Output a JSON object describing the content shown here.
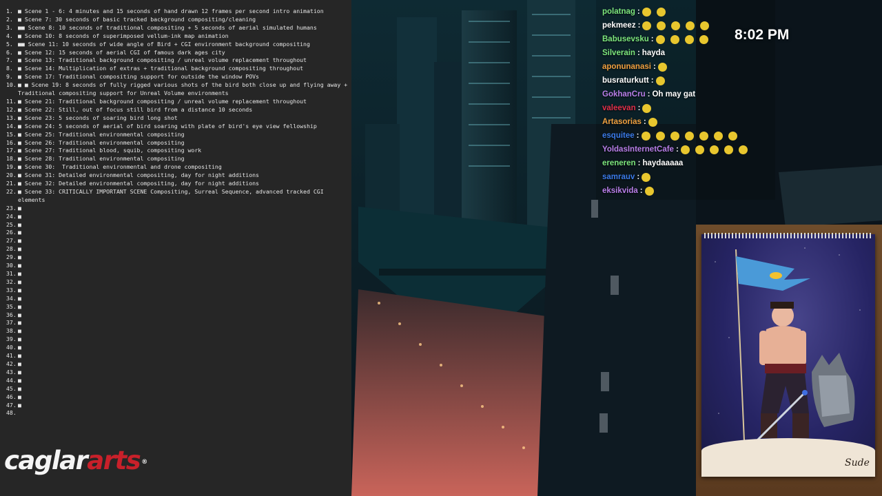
{
  "notes": [
    {
      "n": "1.",
      "t": "■ Scene 1 - 6: 4 minutes and 15 seconds of hand drawn 12 frames per second intro animation"
    },
    {
      "n": "2.",
      "t": "■ Scene 7: 30 seconds of basic tracked background compositing/cleaning"
    },
    {
      "n": "3.",
      "t": "■■ Scene 8: 10 seconds of traditional compositing + 5 seconds of aerial simulated humans"
    },
    {
      "n": "4.",
      "t": "■ Scene 10: 8 seconds of superimposed vellum-ink map animation"
    },
    {
      "n": "5.",
      "t": "■■ Scene 11: 10 seconds of wide angle of Bird + CGI environment background compositing"
    },
    {
      "n": "6.",
      "t": "■ Scene 12: 15 seconds of aerial CGI of famous dark ages city"
    },
    {
      "n": "7.",
      "t": "■ Scene 13: Traditional background compositing / unreal volume replacement throughout"
    },
    {
      "n": "8.",
      "t": "■ Scene 14: Multiplication of extras + traditional background compositing throughout"
    },
    {
      "n": "9.",
      "t": "■ Scene 17: Traditional compositing support for outside the window POVs"
    },
    {
      "n": "10.",
      "t": "■ ■ Scene 19: 8 seconds of fully rigged various shots of the bird both close up and flying away + Traditional compositing support for Unreal Volume environments"
    },
    {
      "n": "11.",
      "t": "■ Scene 21: Traditional background compositing / unreal volume replacement throughout"
    },
    {
      "n": "12.",
      "t": "■ Scene 22: Still, out of focus still bird from a distance 10 seconds"
    },
    {
      "n": "13.",
      "t": "■ Scene 23: 5 seconds of soaring bird long shot"
    },
    {
      "n": "14.",
      "t": "■ Scene 24: 5 seconds of aerial of bird soaring with plate of bird's eye view fellowship"
    },
    {
      "n": "15.",
      "t": "■ Scene 25: Traditional environmental compositing"
    },
    {
      "n": "16.",
      "t": "■ Scene 26: Traditional environmental compositing"
    },
    {
      "n": "17.",
      "t": "■ Scene 27: Traditional blood, squib, compositing work"
    },
    {
      "n": "18.",
      "t": "■ Scene 28: Traditional environmental compositing"
    },
    {
      "n": "19.",
      "t": "■ Scene 30:  Traditional environmental and drone compositing"
    },
    {
      "n": "20.",
      "t": "■ Scene 31: Detailed environmental compositing, day for night additions"
    },
    {
      "n": "21.",
      "t": "■ Scene 32: Detailed environmental compositing, day for night additions"
    },
    {
      "n": "22.",
      "t": "■ Scene 33: CRITICALLY IMPORTANT SCENE Compositing, Surreal Sequence, advanced tracked CGI elements"
    },
    {
      "n": "23.",
      "t": "■"
    },
    {
      "n": "24.",
      "t": "■"
    },
    {
      "n": "25.",
      "t": "■"
    },
    {
      "n": "26.",
      "t": "■"
    },
    {
      "n": "27.",
      "t": "■"
    },
    {
      "n": "28.",
      "t": "■"
    },
    {
      "n": "29.",
      "t": "■"
    },
    {
      "n": "30.",
      "t": "■"
    },
    {
      "n": "31.",
      "t": "■"
    },
    {
      "n": "32.",
      "t": "■"
    },
    {
      "n": "33.",
      "t": "■"
    },
    {
      "n": "34.",
      "t": "■"
    },
    {
      "n": "35.",
      "t": "■"
    },
    {
      "n": "36.",
      "t": "■"
    },
    {
      "n": "37.",
      "t": "■"
    },
    {
      "n": "38.",
      "t": "■"
    },
    {
      "n": "39.",
      "t": "■"
    },
    {
      "n": "40.",
      "t": "■"
    },
    {
      "n": "41.",
      "t": "■"
    },
    {
      "n": "42.",
      "t": "■"
    },
    {
      "n": "43.",
      "t": "■"
    },
    {
      "n": "44.",
      "t": "■"
    },
    {
      "n": "45.",
      "t": "■"
    },
    {
      "n": "46.",
      "t": "■"
    },
    {
      "n": "47.",
      "t": "■"
    },
    {
      "n": "48.",
      "t": ""
    }
  ],
  "logo": {
    "part1": "caglar",
    "part2": "arts",
    "mark": "®"
  },
  "clock": "8:02 PM",
  "chat": [
    {
      "user": "polatnag",
      "color": "#7de67d",
      "msg": "",
      "emotes": 2
    },
    {
      "user": "pekmeez",
      "color": "#ffffff",
      "msg": "",
      "emotes": 5
    },
    {
      "user": "Babusevsku",
      "color": "#7de67d",
      "msg": "",
      "emotes": 4
    },
    {
      "user": "Silverain",
      "color": "#7de67d",
      "msg": "hayda",
      "emotes": 0
    },
    {
      "user": "aponunanasi",
      "color": "#f0a040",
      "msg": "",
      "emotes": 1
    },
    {
      "user": "busraturkutt",
      "color": "#ffffff",
      "msg": "",
      "emotes": 1
    },
    {
      "user": "GokhanCru",
      "color": "#b87ee8",
      "msg": "Oh may gat",
      "emotes": 0
    },
    {
      "user": "valeevan",
      "color": "#e0304a",
      "msg": "",
      "emotes": 1
    },
    {
      "user": "Artasorias",
      "color": "#f0a040",
      "msg": "",
      "emotes": 1
    },
    {
      "user": "esquitee",
      "color": "#3a7ae8",
      "msg": "",
      "emotes": 7
    },
    {
      "user": "YoldasInternetCafe",
      "color": "#b87ee8",
      "msg": "",
      "emotes": 5
    },
    {
      "user": "ereneren",
      "color": "#7de67d",
      "msg": "haydaaaaa",
      "emotes": 0
    },
    {
      "user": "samrauv",
      "color": "#3a7ae8",
      "msg": "",
      "emotes": 1
    },
    {
      "user": "eksikvida",
      "color": "#b87ee8",
      "msg": "",
      "emotes": 1
    }
  ],
  "signature": "Sude"
}
